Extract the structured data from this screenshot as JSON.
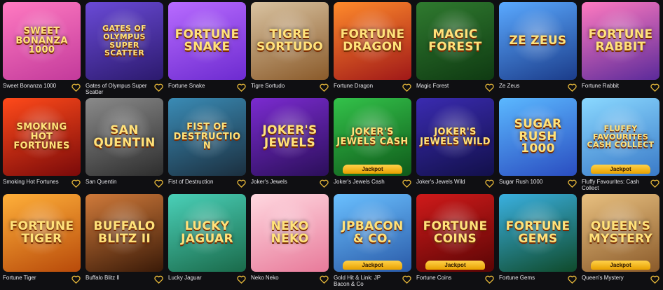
{
  "games": [
    {
      "name": "Sweet Bonanza 1000",
      "art": "SWEET BONANZA 1000",
      "bg": [
        "#ff7ac1",
        "#c33a9b"
      ],
      "jackpot": false
    },
    {
      "name": "Gates of Olympus Super Scatter",
      "art": "GATES OF OLYMPUS SUPER SCATTER",
      "bg": [
        "#6a4ad6",
        "#2c1a6e"
      ],
      "jackpot": false
    },
    {
      "name": "Fortune Snake",
      "art": "FORTUNE SNAKE",
      "bg": [
        "#b86bff",
        "#6d2bd0"
      ],
      "jackpot": false
    },
    {
      "name": "Tigre Sortudo",
      "art": "TIGRE SORTUDO",
      "bg": [
        "#d9c3a1",
        "#8a5a2a"
      ],
      "jackpot": false
    },
    {
      "name": "Fortune Dragon",
      "art": "FORTUNE DRAGON",
      "bg": [
        "#ff8a2b",
        "#a01818"
      ],
      "jackpot": false
    },
    {
      "name": "Magic Forest",
      "art": "MAGIC FOREST",
      "bg": [
        "#2f7a2f",
        "#0f3a12"
      ],
      "jackpot": false
    },
    {
      "name": "Ze Zeus",
      "art": "ZE ZEUS",
      "bg": [
        "#5aa9ff",
        "#1b3c8a"
      ],
      "jackpot": false
    },
    {
      "name": "Fortune Rabbit",
      "art": "FORTUNE RABBIT",
      "bg": [
        "#ff7ac0",
        "#5b2a9a"
      ],
      "jackpot": false
    },
    {
      "name": "Smoking Hot Fortunes",
      "art": "SMOKING HOT FORTUNES",
      "bg": [
        "#ff4a1a",
        "#7a0a0a"
      ],
      "jackpot": false
    },
    {
      "name": "San Quentin",
      "art": "SAN QUENTIN",
      "bg": [
        "#8a8a8a",
        "#2d2d2d"
      ],
      "jackpot": false
    },
    {
      "name": "Fist of Destruction",
      "art": "FIST OF DESTRUCTION",
      "bg": [
        "#3a8bb5",
        "#1b2f3f"
      ],
      "jackpot": false
    },
    {
      "name": "Joker's Jewels",
      "art": "JOKER'S JEWELS",
      "bg": [
        "#7b2bd0",
        "#2b0f5a"
      ],
      "jackpot": false
    },
    {
      "name": "Joker's Jewels Cash",
      "art": "JOKER'S JEWELS CASH",
      "bg": [
        "#33c24a",
        "#0f5a1a"
      ],
      "jackpot": true
    },
    {
      "name": "Joker's Jewels Wild",
      "art": "JOKER'S JEWELS WILD",
      "bg": [
        "#3a2bb0",
        "#12104a"
      ],
      "jackpot": false
    },
    {
      "name": "Sugar Rush 1000",
      "art": "SUGAR RUSH 1000",
      "bg": [
        "#5bb8ff",
        "#2a4dc0"
      ],
      "jackpot": false
    },
    {
      "name": "Fluffy Favourites: Cash Collect",
      "art": "FLUFFY FAVOURITES CASH COLLECT",
      "bg": [
        "#8ad8ff",
        "#3a7ac8"
      ],
      "jackpot": true
    },
    {
      "name": "Fortune Tiger",
      "art": "FORTUNE TIGER",
      "bg": [
        "#ffb03a",
        "#b84a0a"
      ],
      "jackpot": false
    },
    {
      "name": "Buffalo Blitz II",
      "art": "BUFFALO BLITZ II",
      "bg": [
        "#d07a3a",
        "#3a1a08"
      ],
      "jackpot": false
    },
    {
      "name": "Lucky Jaguar",
      "art": "LUCKY JAGUAR",
      "bg": [
        "#4ad0b8",
        "#1a6a4a"
      ],
      "jackpot": false
    },
    {
      "name": "Neko Neko",
      "art": "NEKO NEKO",
      "bg": [
        "#ffd8e0",
        "#e87a9a"
      ],
      "jackpot": false
    },
    {
      "name": "Gold Hit & Link: JP Bacon & Co",
      "art": "JPBACON & CO.",
      "bg": [
        "#6ac0ff",
        "#2a5aa8"
      ],
      "jackpot": true
    },
    {
      "name": "Fortune Coins",
      "art": "FORTUNE COINS",
      "bg": [
        "#d01a1a",
        "#5a0505"
      ],
      "jackpot": true
    },
    {
      "name": "Fortune Gems",
      "art": "FORTUNE GEMS",
      "bg": [
        "#3ab0e0",
        "#0f4a2a"
      ],
      "jackpot": false
    },
    {
      "name": "Queen's Mystery",
      "art": "QUEEN'S MYSTERY",
      "bg": [
        "#e8c080",
        "#8a5a2a"
      ],
      "jackpot": true
    }
  ],
  "jackpot_label": "Jackpot",
  "favorite_icon": "heart-outline-icon",
  "accent_color": "#e8b93a"
}
